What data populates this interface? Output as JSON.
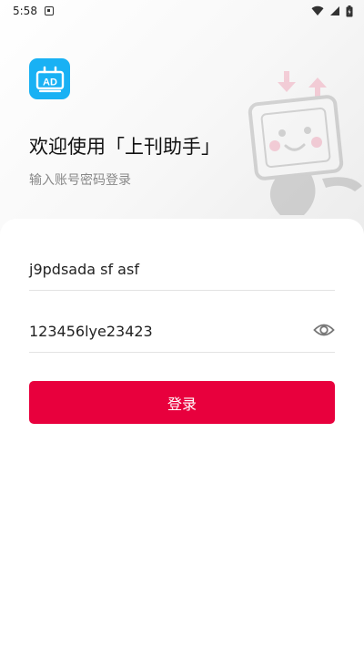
{
  "status_bar": {
    "time": "5:58",
    "notification_icon": "notification-a-icon",
    "wifi_icon": "wifi-icon",
    "signal_icon": "cell-signal-icon",
    "battery_icon": "battery-charging-icon"
  },
  "header": {
    "logo_icon": "ad-board-icon",
    "logo_text": "AD",
    "title": "欢迎使用「上刊助手」",
    "subtitle": "输入账号密码登录"
  },
  "form": {
    "username_value": "j9pdsada sf asf",
    "password_value": "123456lye23423",
    "toggle_visibility_icon": "eye-icon",
    "login_label": "登录"
  },
  "colors": {
    "brand_blue": "#19b1f4",
    "button_red": "#e8003d"
  }
}
